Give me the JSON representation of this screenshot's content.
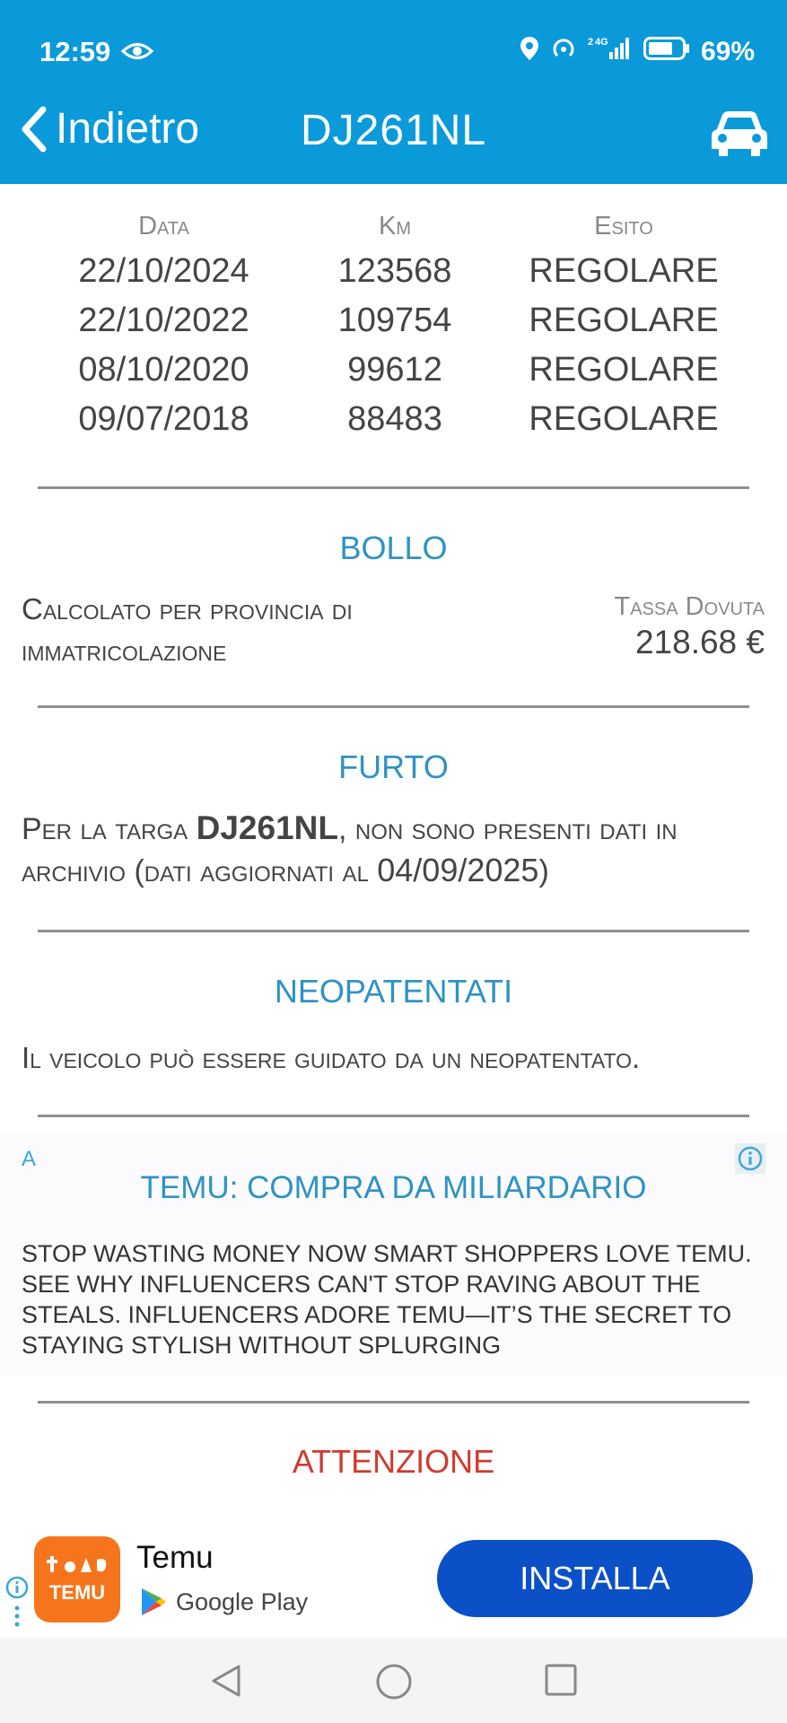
{
  "status_bar": {
    "time": "12:59",
    "battery": "69%",
    "network": "4G"
  },
  "header": {
    "back_label": "Indietro",
    "title": "DJ261NL",
    "car_icon": "car-icon",
    "background": "#0a9ad9"
  },
  "revisioni": {
    "columns": [
      "Data",
      "Km",
      "Esito"
    ],
    "rows": [
      {
        "data": "22/10/2024",
        "km": "123568",
        "esito": "REGOLARE"
      },
      {
        "data": "22/10/2022",
        "km": "109754",
        "esito": "REGOLARE"
      },
      {
        "data": "08/10/2020",
        "km": "99612",
        "esito": "REGOLARE"
      },
      {
        "data": "09/07/2018",
        "km": "88483",
        "esito": "REGOLARE"
      }
    ]
  },
  "bollo": {
    "title": "BOLLO",
    "line1": "Calcolato per provincia di",
    "line2": "immatricolazione",
    "tassa_label": "Tassa Dovuta",
    "tassa_value": "218.68 €"
  },
  "furto": {
    "title": "FURTO",
    "prefix": "Per la targa ",
    "plate": "DJ261NL",
    "suffix": ", non sono presenti dati in",
    "line2_prefix": "archivio (dati aggiornati al ",
    "date": "04/09/2025",
    "line2_suffix": ")"
  },
  "neopatentati": {
    "title": "NEOPATENTATI",
    "text": "Il veicolo può essere guidato da un neopatentato."
  },
  "ad": {
    "badge": "A",
    "title": "TEMU: COMPRA DA MILIARDARIO",
    "text": "STOP WASTING MONEY NOW SMART SHOPPERS LOVE TEMU. SEE WHY INFLUENCERS CAN'T STOP RAVING ABOUT THE STEALS. INFLUENCERS ADORE TEMU—IT’S THE SECRET TO STAYING STYLISH WITHOUT SPLURGING"
  },
  "attenzione": {
    "title": "ATTENZIONE",
    "color": "#cf3b2f"
  },
  "install_banner": {
    "app_icon_text": "TEMU",
    "app_name": "Temu",
    "store": "Google Play",
    "install_label": "INSTALLA",
    "button_color": "#0b50c7"
  }
}
